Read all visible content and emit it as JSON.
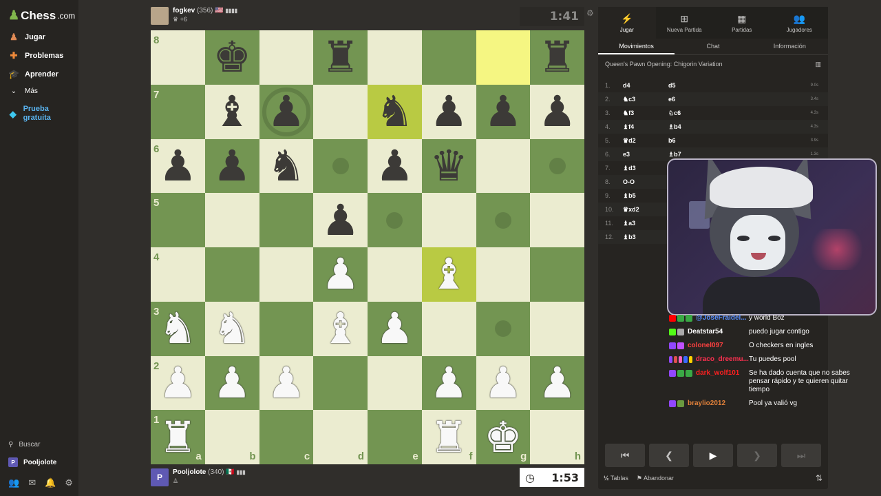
{
  "sidebar": {
    "logo": "Chess",
    "logo_suffix": ".com",
    "items": [
      {
        "label": "Jugar",
        "icon": "play-pawn-icon"
      },
      {
        "label": "Problemas",
        "icon": "puzzle-icon"
      },
      {
        "label": "Aprender",
        "icon": "learn-icon"
      },
      {
        "label": "Más",
        "icon": "chevron-down-icon"
      },
      {
        "label": "Prueba gratuita",
        "icon": "diamond-icon"
      }
    ],
    "search_label": "Buscar",
    "user_label": "Pooljolote",
    "user_initial": "P"
  },
  "top_player": {
    "name": "fogkev",
    "rating": "(356)",
    "flag": "🇺🇸",
    "material": "+6",
    "clock": "1:41"
  },
  "bottom_player": {
    "name": "Pooljolote",
    "rating": "(340)",
    "flag": "🇲🇽",
    "initial": "P",
    "clock": "1:53"
  },
  "board": {
    "files": [
      "a",
      "b",
      "c",
      "d",
      "e",
      "f",
      "g",
      "h"
    ],
    "ranks": [
      "8",
      "7",
      "6",
      "5",
      "4",
      "3",
      "2",
      "1"
    ],
    "rows": [
      [
        "",
        "bk",
        "",
        "br",
        "",
        "",
        "",
        "br"
      ],
      [
        "",
        "bb",
        "bp",
        "",
        "bn",
        "bp",
        "bp",
        "bp"
      ],
      [
        "bp",
        "bp",
        "bn",
        "",
        "bp",
        "bq",
        "",
        ""
      ],
      [
        "",
        "",
        "",
        "bp",
        "",
        "",
        "",
        ""
      ],
      [
        "",
        "",
        "",
        "wp",
        "",
        "wb",
        "",
        ""
      ],
      [
        "wn",
        "wn",
        "",
        "wb",
        "wp",
        "",
        "",
        ""
      ],
      [
        "wp",
        "wp",
        "wp",
        "",
        "",
        "wp",
        "wp",
        "wp"
      ],
      [
        "wr",
        "",
        "",
        "",
        "",
        "wr",
        "wk",
        ""
      ]
    ],
    "highlights": [
      "g8",
      "e7",
      "f4"
    ],
    "dots": [
      "d6",
      "h6",
      "e5",
      "g5",
      "g3"
    ],
    "rings": [
      "c7"
    ]
  },
  "panel": {
    "top_tabs": [
      {
        "label": "Jugar",
        "icon": "lightning-icon"
      },
      {
        "label": "Nueva Partida",
        "icon": "plus-icon"
      },
      {
        "label": "Partidas",
        "icon": "board-icon"
      },
      {
        "label": "Jugadores",
        "icon": "players-icon"
      }
    ],
    "sub_tabs": [
      "Movimientos",
      "Chat",
      "Información"
    ],
    "opening": "Queen's Pawn Opening: Chigorin Variation",
    "moves": [
      {
        "n": "1.",
        "w": "d4",
        "b": "d5",
        "t": "9.0s"
      },
      {
        "n": "2.",
        "w": "♞c3",
        "b": "e6",
        "t": "3.4s"
      },
      {
        "n": "3.",
        "w": "♞f3",
        "b": "♘c6",
        "t": "4.3s"
      },
      {
        "n": "4.",
        "w": "♝f4",
        "b": "♗b4",
        "t": "4.3s"
      },
      {
        "n": "5.",
        "w": "♛d2",
        "b": "b6",
        "t": "3.9s"
      },
      {
        "n": "6.",
        "w": "e3",
        "b": "♗b7",
        "t": "1.3s"
      },
      {
        "n": "7.",
        "w": "♝d3",
        "b": "",
        "t": ""
      },
      {
        "n": "8.",
        "w": "O-O",
        "b": "",
        "t": ""
      },
      {
        "n": "9.",
        "w": "♝b5",
        "b": "",
        "t": ""
      },
      {
        "n": "10.",
        "w": "♛xd2",
        "b": "",
        "t": ""
      },
      {
        "n": "11.",
        "w": "♝a3",
        "b": "",
        "t": ""
      },
      {
        "n": "12.",
        "w": "♝b3",
        "b": "",
        "t": ""
      }
    ],
    "footer_draw": "Tablas",
    "footer_draw_prefix": "½",
    "footer_resign": "Abandonar"
  },
  "chat": [
    {
      "user": "@JoséFraidel...",
      "text": "y world Boz",
      "color": "#5a8fff"
    },
    {
      "user": "Deatstar54",
      "text": "puedo jugar contigo",
      "color": "#ffffff"
    },
    {
      "user": "colonel097",
      "text": "O checkers en ingles",
      "color": "#ff4040"
    },
    {
      "user": "draco_dreemu...",
      "text": "Tu puedes pool",
      "color": "#ff3050"
    },
    {
      "user": "dark_wolf101",
      "text": "Se ha dado cuenta que no sabes pensar rápido y te quieren quitar tiempo",
      "color": "#ff2020"
    },
    {
      "user": "braylio2012",
      "text": "Pool ya valió vg",
      "color": "#e0803a"
    }
  ]
}
